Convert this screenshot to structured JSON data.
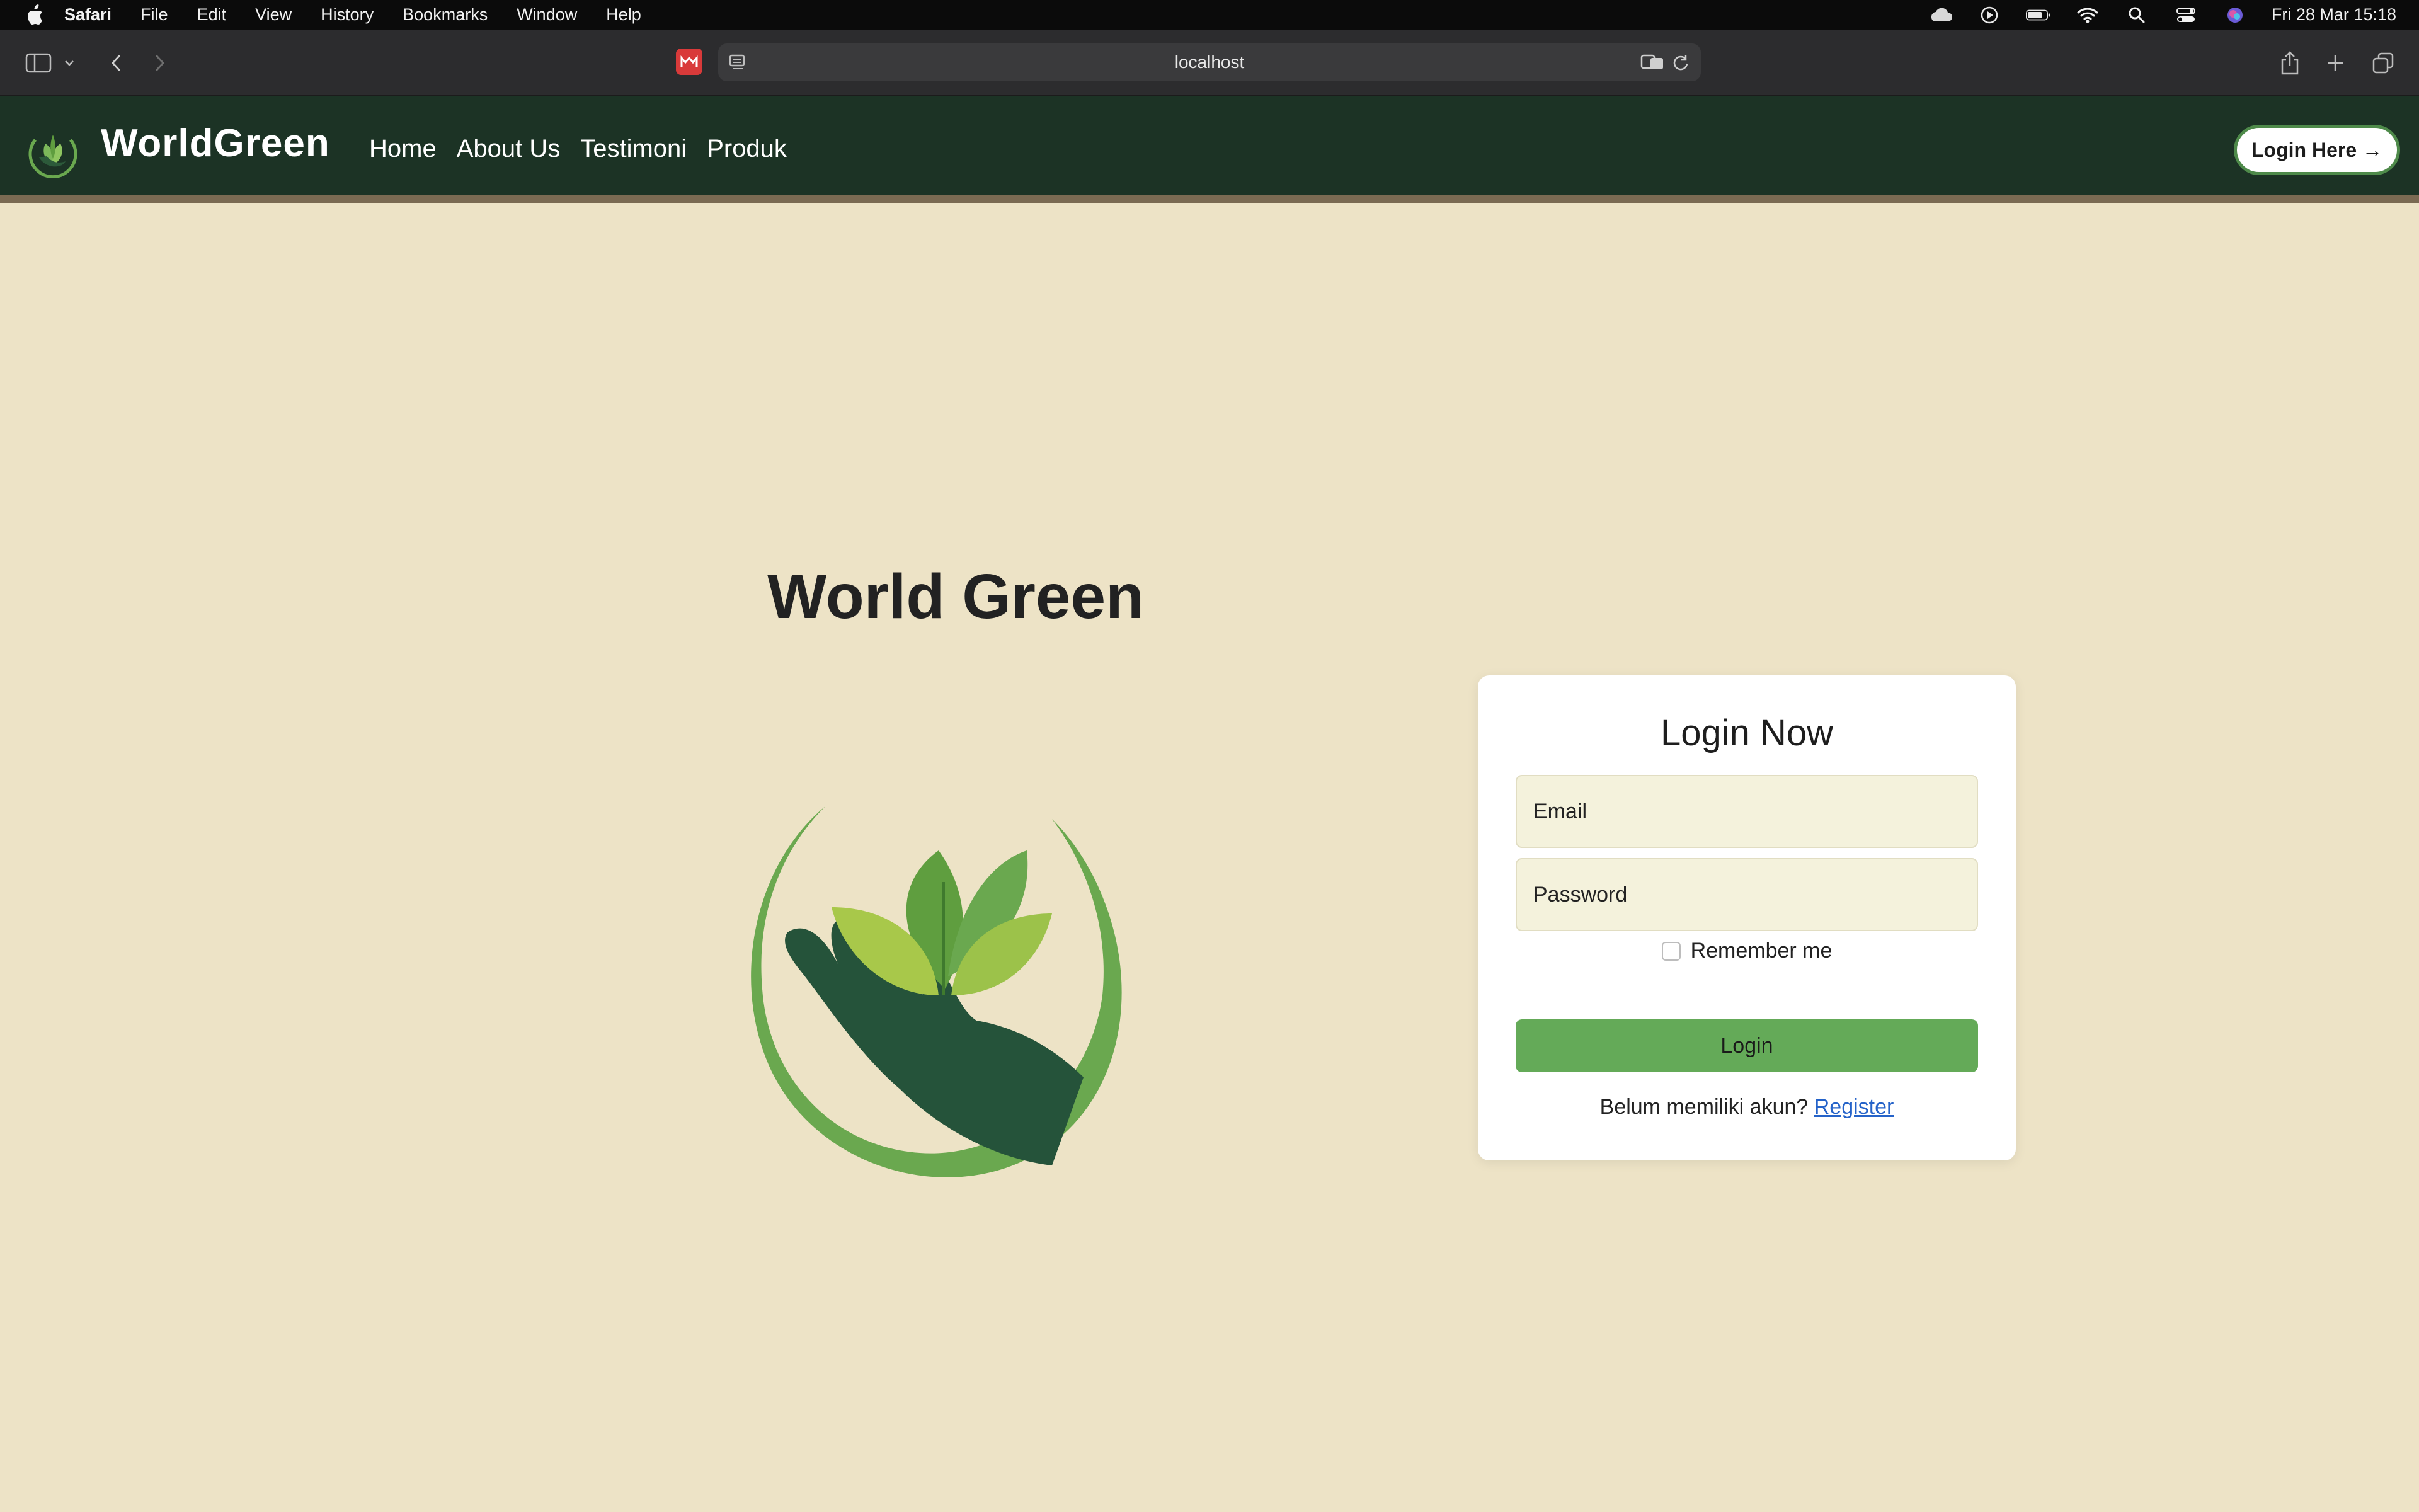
{
  "menubar": {
    "app": "Safari",
    "items": [
      "File",
      "Edit",
      "View",
      "History",
      "Bookmarks",
      "Window",
      "Help"
    ],
    "clock": "Fri 28 Mar  15:18"
  },
  "browser": {
    "url": "localhost"
  },
  "site": {
    "brand": "WorldGreen",
    "nav": [
      "Home",
      "About Us",
      "Testimoni",
      "Produk"
    ],
    "login_here": "Login Here →"
  },
  "hero": {
    "title": "World Green"
  },
  "login": {
    "title": "Login Now",
    "email_placeholder": "Email",
    "password_placeholder": "Password",
    "remember": "Remember me",
    "button": "Login",
    "register_prompt": "Belum memiliki akun?",
    "register_link": "Register"
  },
  "colors": {
    "page_bg": "#ede3c6",
    "nav_bg": "#1c3325",
    "button_green": "#64aa58",
    "link_blue": "#2563c9"
  }
}
